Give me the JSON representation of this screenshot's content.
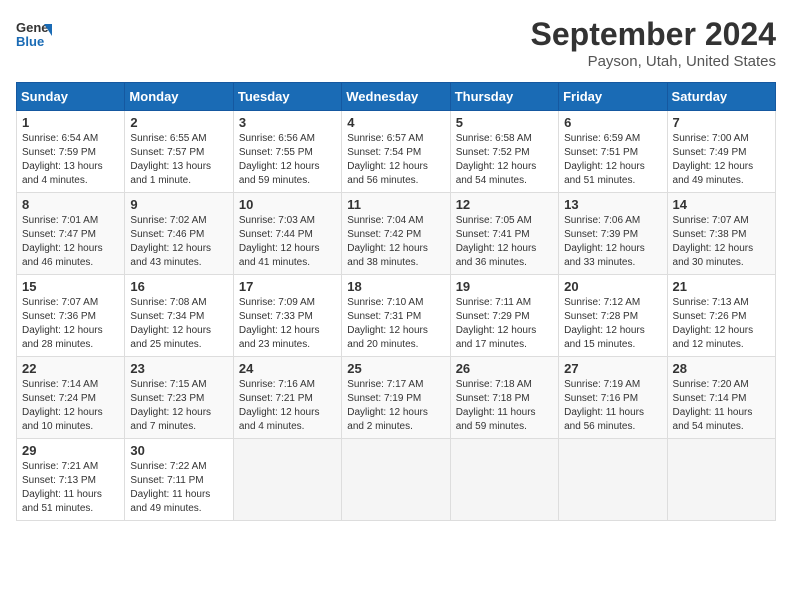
{
  "header": {
    "logo_line1": "General",
    "logo_line2": "Blue",
    "month": "September 2024",
    "location": "Payson, Utah, United States"
  },
  "weekdays": [
    "Sunday",
    "Monday",
    "Tuesday",
    "Wednesday",
    "Thursday",
    "Friday",
    "Saturday"
  ],
  "weeks": [
    [
      {
        "day": "1",
        "info": "Sunrise: 6:54 AM\nSunset: 7:59 PM\nDaylight: 13 hours\nand 4 minutes."
      },
      {
        "day": "2",
        "info": "Sunrise: 6:55 AM\nSunset: 7:57 PM\nDaylight: 13 hours\nand 1 minute."
      },
      {
        "day": "3",
        "info": "Sunrise: 6:56 AM\nSunset: 7:55 PM\nDaylight: 12 hours\nand 59 minutes."
      },
      {
        "day": "4",
        "info": "Sunrise: 6:57 AM\nSunset: 7:54 PM\nDaylight: 12 hours\nand 56 minutes."
      },
      {
        "day": "5",
        "info": "Sunrise: 6:58 AM\nSunset: 7:52 PM\nDaylight: 12 hours\nand 54 minutes."
      },
      {
        "day": "6",
        "info": "Sunrise: 6:59 AM\nSunset: 7:51 PM\nDaylight: 12 hours\nand 51 minutes."
      },
      {
        "day": "7",
        "info": "Sunrise: 7:00 AM\nSunset: 7:49 PM\nDaylight: 12 hours\nand 49 minutes."
      }
    ],
    [
      {
        "day": "8",
        "info": "Sunrise: 7:01 AM\nSunset: 7:47 PM\nDaylight: 12 hours\nand 46 minutes."
      },
      {
        "day": "9",
        "info": "Sunrise: 7:02 AM\nSunset: 7:46 PM\nDaylight: 12 hours\nand 43 minutes."
      },
      {
        "day": "10",
        "info": "Sunrise: 7:03 AM\nSunset: 7:44 PM\nDaylight: 12 hours\nand 41 minutes."
      },
      {
        "day": "11",
        "info": "Sunrise: 7:04 AM\nSunset: 7:42 PM\nDaylight: 12 hours\nand 38 minutes."
      },
      {
        "day": "12",
        "info": "Sunrise: 7:05 AM\nSunset: 7:41 PM\nDaylight: 12 hours\nand 36 minutes."
      },
      {
        "day": "13",
        "info": "Sunrise: 7:06 AM\nSunset: 7:39 PM\nDaylight: 12 hours\nand 33 minutes."
      },
      {
        "day": "14",
        "info": "Sunrise: 7:07 AM\nSunset: 7:38 PM\nDaylight: 12 hours\nand 30 minutes."
      }
    ],
    [
      {
        "day": "15",
        "info": "Sunrise: 7:07 AM\nSunset: 7:36 PM\nDaylight: 12 hours\nand 28 minutes."
      },
      {
        "day": "16",
        "info": "Sunrise: 7:08 AM\nSunset: 7:34 PM\nDaylight: 12 hours\nand 25 minutes."
      },
      {
        "day": "17",
        "info": "Sunrise: 7:09 AM\nSunset: 7:33 PM\nDaylight: 12 hours\nand 23 minutes."
      },
      {
        "day": "18",
        "info": "Sunrise: 7:10 AM\nSunset: 7:31 PM\nDaylight: 12 hours\nand 20 minutes."
      },
      {
        "day": "19",
        "info": "Sunrise: 7:11 AM\nSunset: 7:29 PM\nDaylight: 12 hours\nand 17 minutes."
      },
      {
        "day": "20",
        "info": "Sunrise: 7:12 AM\nSunset: 7:28 PM\nDaylight: 12 hours\nand 15 minutes."
      },
      {
        "day": "21",
        "info": "Sunrise: 7:13 AM\nSunset: 7:26 PM\nDaylight: 12 hours\nand 12 minutes."
      }
    ],
    [
      {
        "day": "22",
        "info": "Sunrise: 7:14 AM\nSunset: 7:24 PM\nDaylight: 12 hours\nand 10 minutes."
      },
      {
        "day": "23",
        "info": "Sunrise: 7:15 AM\nSunset: 7:23 PM\nDaylight: 12 hours\nand 7 minutes."
      },
      {
        "day": "24",
        "info": "Sunrise: 7:16 AM\nSunset: 7:21 PM\nDaylight: 12 hours\nand 4 minutes."
      },
      {
        "day": "25",
        "info": "Sunrise: 7:17 AM\nSunset: 7:19 PM\nDaylight: 12 hours\nand 2 minutes."
      },
      {
        "day": "26",
        "info": "Sunrise: 7:18 AM\nSunset: 7:18 PM\nDaylight: 11 hours\nand 59 minutes."
      },
      {
        "day": "27",
        "info": "Sunrise: 7:19 AM\nSunset: 7:16 PM\nDaylight: 11 hours\nand 56 minutes."
      },
      {
        "day": "28",
        "info": "Sunrise: 7:20 AM\nSunset: 7:14 PM\nDaylight: 11 hours\nand 54 minutes."
      }
    ],
    [
      {
        "day": "29",
        "info": "Sunrise: 7:21 AM\nSunset: 7:13 PM\nDaylight: 11 hours\nand 51 minutes."
      },
      {
        "day": "30",
        "info": "Sunrise: 7:22 AM\nSunset: 7:11 PM\nDaylight: 11 hours\nand 49 minutes."
      },
      {
        "day": "",
        "info": ""
      },
      {
        "day": "",
        "info": ""
      },
      {
        "day": "",
        "info": ""
      },
      {
        "day": "",
        "info": ""
      },
      {
        "day": "",
        "info": ""
      }
    ]
  ]
}
